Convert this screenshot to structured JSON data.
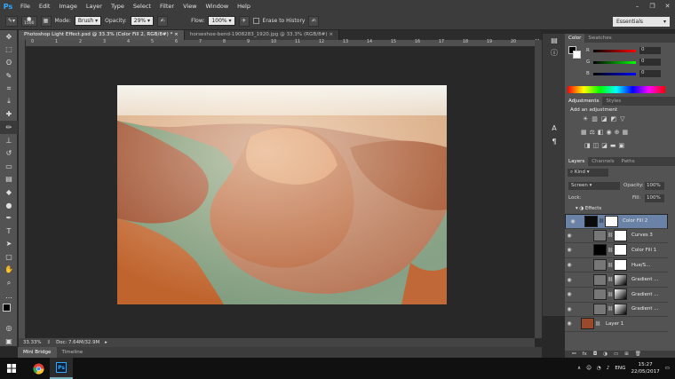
{
  "app": {
    "logo": "Ps",
    "menu": [
      "File",
      "Edit",
      "Image",
      "Layer",
      "Type",
      "Select",
      "Filter",
      "View",
      "Window",
      "Help"
    ],
    "window_controls": [
      "–",
      "❐",
      "✕"
    ]
  },
  "options": {
    "brush_size": "1500",
    "mode_label": "Mode:",
    "mode_value": "Brush",
    "opacity_label": "Opacity:",
    "opacity_value": "29%",
    "flow_label": "Flow:",
    "flow_value": "100%",
    "erase_history": "Erase to History",
    "workspace": "Essentials"
  },
  "tabs": [
    {
      "label": "Photoshop Light Effect.psd @ 33.3% (Color Fill 2, RGB/8#) *",
      "close": "×"
    },
    {
      "label": "horseshoe-bend-1908283_1920.jpg @ 33.3% (RGB/8#)",
      "close": "×"
    }
  ],
  "ruler": [
    "0",
    "1",
    "2",
    "3",
    "4",
    "5",
    "6",
    "7",
    "8",
    "9",
    "10",
    "11",
    "12",
    "13",
    "14",
    "15",
    "16",
    "17",
    "18",
    "19",
    "20",
    "21"
  ],
  "status": {
    "zoom": "33.33%",
    "doc": "Doc: 7.64M/32.9M"
  },
  "bottom_tabs": [
    "Mini Bridge",
    "Timeline"
  ],
  "color_panel": {
    "tabs": [
      "Color",
      "Swatches"
    ],
    "r_label": "R",
    "g_label": "G",
    "b_label": "B",
    "r": "0",
    "g": "0",
    "b": "0"
  },
  "adjustments": {
    "tabs": [
      "Adjustments",
      "Styles"
    ],
    "heading": "Add an adjustment"
  },
  "layers_panel": {
    "tabs": [
      "Layers",
      "Channels",
      "Paths"
    ],
    "kind": "Kind",
    "blend": "Screen",
    "opacity_label": "Opacity:",
    "opacity": "100%",
    "lock_label": "Lock:",
    "fill_label": "Fill:",
    "fill": "100%",
    "effects_label": "Effects"
  },
  "layers": [
    {
      "name": "Color Fill 2",
      "selected": true,
      "thumb": "#0a0a0a"
    },
    {
      "name": "Curves 3",
      "selected": false,
      "thumb": "#777"
    },
    {
      "name": "Color Fill 1",
      "selected": false,
      "thumb": "#000"
    },
    {
      "name": "Hue/S...",
      "selected": false,
      "thumb": "#777"
    },
    {
      "name": "Gradient ...",
      "selected": false,
      "thumb": "#777"
    },
    {
      "name": "Gradient ...",
      "selected": false,
      "thumb": "#777"
    },
    {
      "name": "Gradient ...",
      "selected": false,
      "thumb": "#777"
    },
    {
      "name": "Layer 1",
      "selected": false,
      "thumb": "#9a4a2a"
    }
  ],
  "taskbar": {
    "lang": "ENG",
    "time": "15:27",
    "date": "22/05/2017"
  }
}
